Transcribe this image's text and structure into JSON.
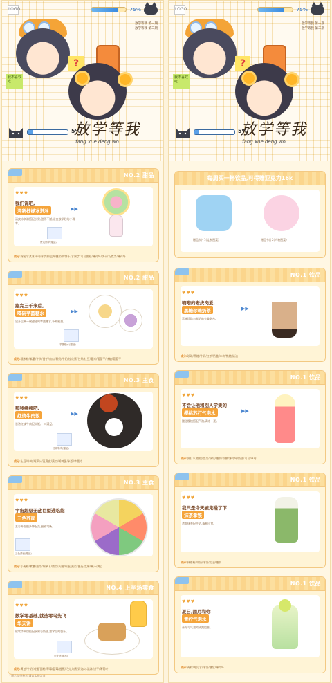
{
  "header": {
    "hud_percent": "75%",
    "hud_fill": 0.75,
    "progress_percent": "5%",
    "progress_fill": 0.05,
    "title_cn": "放学等我",
    "title_pinyin": "fang xue deng wo",
    "side_notes": [
      "放学等我 第一期",
      "放学等我 第二期"
    ],
    "sticky_note": "我不喜欢吃"
  },
  "left_cards": [
    {
      "rank": "NO.2 甜品",
      "line1": "我们说吧,",
      "line2": "清新柠檬冰淇淋",
      "desc": "清爽冰淇淋搭配水果,甜而不腻,适合放学后的小确幸。",
      "thumb_caption": "蒙达同学(赠品)",
      "ingredients_label": "成分:",
      "ingredients": "绵密冰淇淋/草莓冰淇淋/蓝莓糖浆碎/饼干/水果丁/可可脆粒/薄荷叶/饼干/巧克力/薄荷叶"
    },
    {
      "rank": "NO.2 甜品",
      "line1": "跑完三千米后,",
      "line2": "喝碗芋圆糖水",
      "desc": "出汗后来一碗甜甜的芋圆糖水,补充能量。",
      "thumb_caption": "芋圆糖水(赠品)",
      "ingredients_label": "成分:",
      "ingredients": "糯米粉/紫薯/芋头/香芋/南瓜/椰奶/牛奶/桂花蜜/芒果/红豆/薏米/葡萄干/冰糖/葡萄干"
    },
    {
      "rank": "NO.3 主食",
      "line1": "那我继续吧,",
      "line2": "红烧牛肉饭",
      "desc": "香浓红烧牛肉配米饭,一口满足。",
      "thumb_caption": "红烧牛肉(赠品)",
      "ingredients_label": "成分:",
      "ingredients": "土豆/牛肉/胡萝卜/豆腐皮/黄瓜/鹌鹑蛋/米饭/芋圆片"
    },
    {
      "rank": "NO.3 主食",
      "line1": "宇宙超级无敌巨型通吃能",
      "line2": "三色荞面",
      "desc": "五彩荞面配多种配菜,营养均衡。",
      "thumb_caption": "三色荞面(赠品)",
      "ingredients_label": "成分:",
      "ingredients": "小麦粉/紫薯/菠菜/胡萝卜/南瓜/火腿/鸡蛋/黄瓜/番茄/芝麻/酱汁/海苔"
    },
    {
      "rank": "NO.4 上半场零食",
      "line1": "数学零基础,就选零乌先飞",
      "line2": "华夫饼",
      "desc": "松软华夫饼搭配水果与奶油,放学后的快乐。",
      "thumb_caption": "华夫饼(赠品)",
      "ingredients_label": "成分:",
      "ingredients": "黄油/牛奶/鸡蛋/面粉/草莓/蓝莓/香蕉/巧克力酱/奶油/冰淇淋/饼干/薄荷叶"
    }
  ],
  "right_banner": {
    "title": "每周买一杯饮品,可得赠亚克力16k",
    "stand1_caption": "赠品卡片1(定制图案)",
    "stand2_caption": "赠品卡片2(人物图案)"
  },
  "right_cards": [
    {
      "rank": "NO.1 饮品",
      "line1": "嘀嗒的老虎肉爱,",
      "line2": "黑糖珍珠奶茶",
      "desc": "黑糖珍珠与鲜奶的完美融合。",
      "ingredients_label": "成分:",
      "ingredients": "珍珠/黑糖/牛奶/红茶/奶盖/冰块/焦糖/奶油"
    },
    {
      "rank": "NO.1 饮品",
      "line1": "不会让他和别人学卖的",
      "line2": "樱桃苏打气泡水",
      "desc": "酸甜樱桃搭配气泡,清凉一夏。",
      "ingredients_label": "成分:",
      "ingredients": "苏打水/樱桃/西瓜/冰块/糖浆/柠檬/薄荷叶/奶油/可可/草莓"
    },
    {
      "rank": "NO.1 饮品",
      "line1": "我只是今天被鬼碰了下",
      "line2": "抹茶拿铁",
      "desc": "浓郁抹茶配牛奶,清新回甘。",
      "ingredients_label": "成分:",
      "ingredients": "抹茶粉/牛奶/冰块/奶油/糖浆"
    },
    {
      "rank": "NO.1 饮品",
      "line1": "夏日,圆月和你",
      "line2": "青柠气泡水",
      "desc": "青柠与气泡的清爽组合。",
      "ingredients_label": "成分:",
      "ingredients": "青柠/苏打水/冰块/糖浆/薄荷叶"
    }
  ],
  "footer": "* 图片仅供参考,请以实物为准"
}
